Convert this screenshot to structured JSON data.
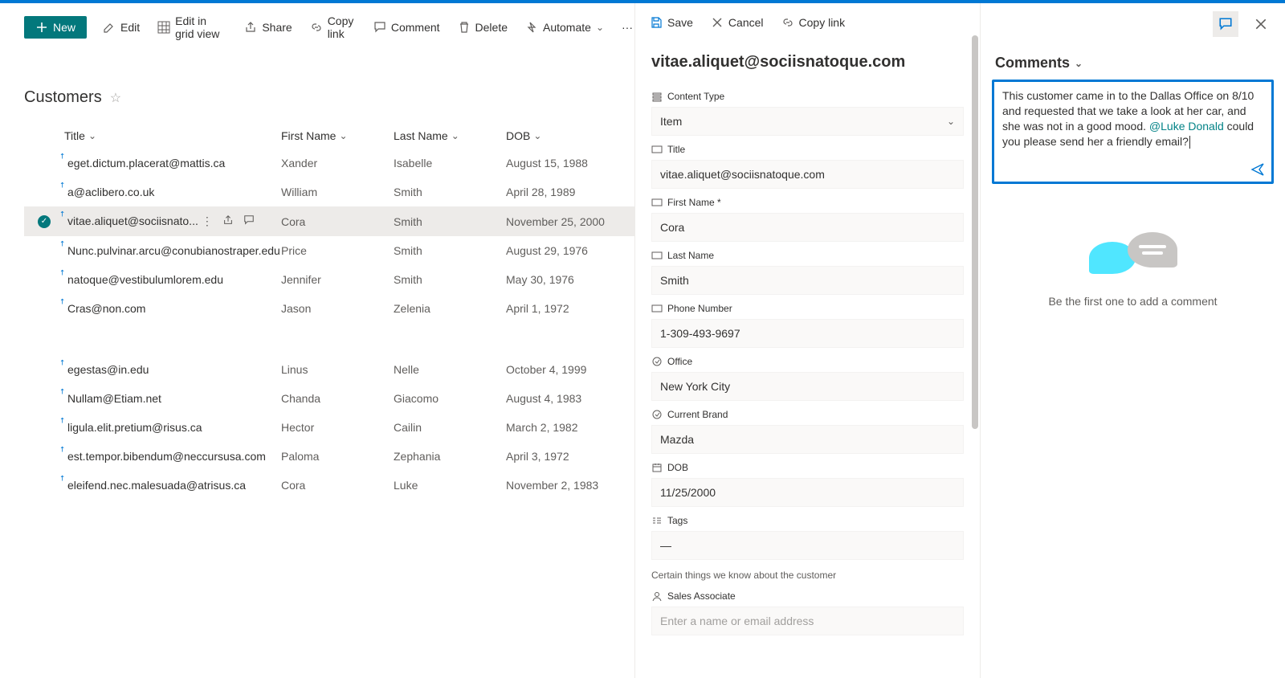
{
  "detail_actions": {
    "save": "Save",
    "cancel": "Cancel",
    "copylink": "Copy link"
  },
  "toolbar": {
    "new": "New",
    "edit": "Edit",
    "edit_grid": "Edit in grid view",
    "share": "Share",
    "copylink": "Copy link",
    "comment": "Comment",
    "delete": "Delete",
    "automate": "Automate",
    "more": "···"
  },
  "list": {
    "title": "Customers",
    "columns": {
      "title": "Title",
      "first_name": "First Name",
      "last_name": "Last Name",
      "dob": "DOB"
    },
    "rows": [
      {
        "title": "eget.dictum.placerat@mattis.ca",
        "fn": "Xander",
        "ln": "Isabelle",
        "dob": "August 15, 1988"
      },
      {
        "title": "a@aclibero.co.uk",
        "fn": "William",
        "ln": "Smith",
        "dob": "April 28, 1989"
      },
      {
        "title": "vitae.aliquet@sociisnato...",
        "fn": "Cora",
        "ln": "Smith",
        "dob": "November 25, 2000",
        "selected": true
      },
      {
        "title": "Nunc.pulvinar.arcu@conubianostraper.edu",
        "fn": "Price",
        "ln": "Smith",
        "dob": "August 29, 1976"
      },
      {
        "title": "natoque@vestibulumlorem.edu",
        "fn": "Jennifer",
        "ln": "Smith",
        "dob": "May 30, 1976"
      },
      {
        "title": "Cras@non.com",
        "fn": "Jason",
        "ln": "Zelenia",
        "dob": "April 1, 1972"
      },
      {
        "title": "egestas@in.edu",
        "fn": "Linus",
        "ln": "Nelle",
        "dob": "October 4, 1999"
      },
      {
        "title": "Nullam@Etiam.net",
        "fn": "Chanda",
        "ln": "Giacomo",
        "dob": "August 4, 1983"
      },
      {
        "title": "ligula.elit.pretium@risus.ca",
        "fn": "Hector",
        "ln": "Cailin",
        "dob": "March 2, 1982"
      },
      {
        "title": "est.tempor.bibendum@neccursusa.com",
        "fn": "Paloma",
        "ln": "Zephania",
        "dob": "April 3, 1972"
      },
      {
        "title": "eleifend.nec.malesuada@atrisus.ca",
        "fn": "Cora",
        "ln": "Luke",
        "dob": "November 2, 1983"
      }
    ]
  },
  "detail": {
    "heading": "vitae.aliquet@sociisnatoque.com",
    "fields": {
      "content_type_label": "Content Type",
      "content_type_value": "Item",
      "title_label": "Title",
      "title_value": "vitae.aliquet@sociisnatoque.com",
      "first_name_label": "First Name *",
      "first_name_value": "Cora",
      "last_name_label": "Last Name",
      "last_name_value": "Smith",
      "phone_label": "Phone Number",
      "phone_value": "1-309-493-9697",
      "office_label": "Office",
      "office_value": "New York City",
      "brand_label": "Current Brand",
      "brand_value": "Mazda",
      "dob_label": "DOB",
      "dob_value": "11/25/2000",
      "tags_label": "Tags",
      "tags_value": "—",
      "section_note": "Certain things we know about the customer",
      "sa_label": "Sales Associate",
      "sa_placeholder": "Enter a name or email address"
    }
  },
  "comments": {
    "heading": "Comments",
    "draft_pre": "This customer came in to the Dallas Office on 8/10 and requested that we take a look at her car, and she was not in a good mood. ",
    "mention": "@Luke Donald",
    "draft_post": " could you please send her a friendly email?",
    "empty": "Be the first one to add a comment"
  }
}
